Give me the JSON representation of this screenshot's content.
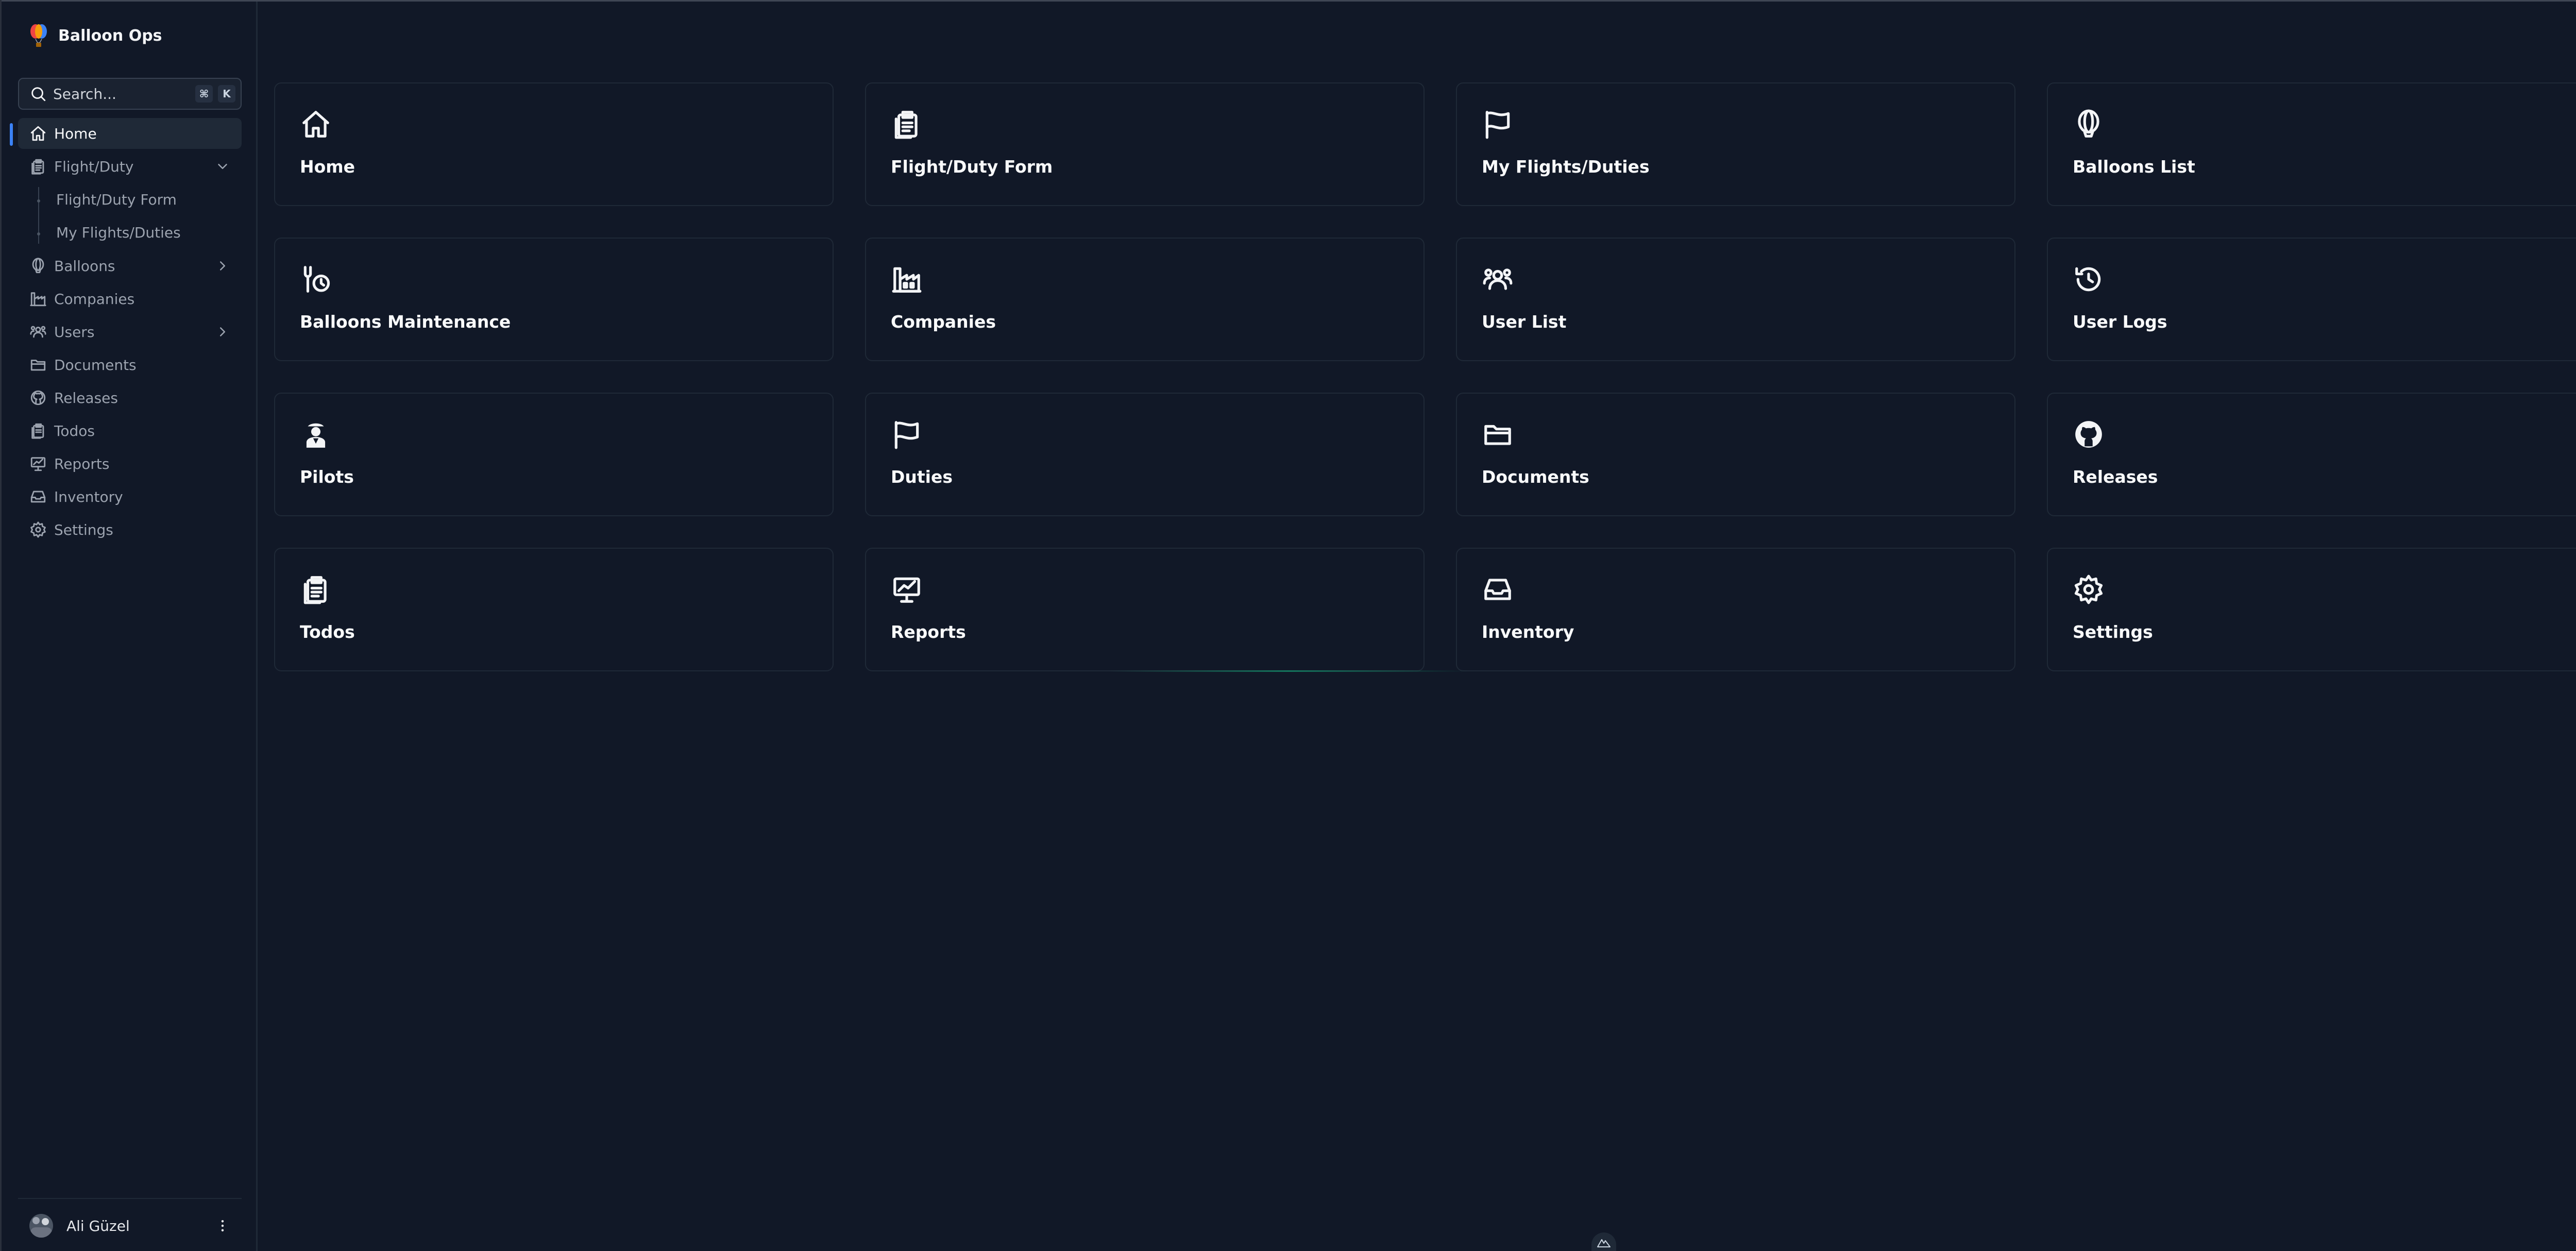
{
  "app": {
    "name": "Balloon Ops"
  },
  "search": {
    "placeholder": "Search...",
    "shortcut_keys": [
      "⌘",
      "K"
    ]
  },
  "sidebar": {
    "items": [
      {
        "label": "Home",
        "icon": "home-icon",
        "active": true
      },
      {
        "label": "Flight/Duty",
        "icon": "clipboard-icon",
        "expanded": true,
        "children": [
          "Flight/Duty Form",
          "My Flights/Duties"
        ]
      },
      {
        "label": "Balloons",
        "icon": "balloon-icon",
        "has_children": true
      },
      {
        "label": "Companies",
        "icon": "factory-icon"
      },
      {
        "label": "Users",
        "icon": "users-icon",
        "has_children": true
      },
      {
        "label": "Documents",
        "icon": "folder-icon"
      },
      {
        "label": "Releases",
        "icon": "github-icon"
      },
      {
        "label": "Todos",
        "icon": "clipboard-icon"
      },
      {
        "label": "Reports",
        "icon": "presentation-chart-icon"
      },
      {
        "label": "Inventory",
        "icon": "inbox-icon"
      },
      {
        "label": "Settings",
        "icon": "gear-icon"
      }
    ]
  },
  "user": {
    "name": "Ali Güzel"
  },
  "cards": [
    {
      "title": "Home",
      "icon": "home-icon"
    },
    {
      "title": "Flight/Duty Form",
      "icon": "clipboard-icon"
    },
    {
      "title": "My Flights/Duties",
      "icon": "flag-icon"
    },
    {
      "title": "Balloons List",
      "icon": "balloon-icon"
    },
    {
      "title": "Balloons Maintenance",
      "icon": "wrench-clock-icon"
    },
    {
      "title": "Companies",
      "icon": "factory-icon"
    },
    {
      "title": "User List",
      "icon": "users-icon"
    },
    {
      "title": "User Logs",
      "icon": "history-icon"
    },
    {
      "title": "Pilots",
      "icon": "pilot-icon"
    },
    {
      "title": "Duties",
      "icon": "flag-icon"
    },
    {
      "title": "Documents",
      "icon": "folder-icon"
    },
    {
      "title": "Releases",
      "icon": "github-icon"
    },
    {
      "title": "Todos",
      "icon": "clipboard-icon"
    },
    {
      "title": "Reports",
      "icon": "presentation-chart-icon"
    },
    {
      "title": "Inventory",
      "icon": "inbox-icon"
    },
    {
      "title": "Settings",
      "icon": "gear-icon"
    }
  ],
  "colors": {
    "background": "#111827",
    "accent": "#3b82f6",
    "card_border": "#1f2937"
  }
}
